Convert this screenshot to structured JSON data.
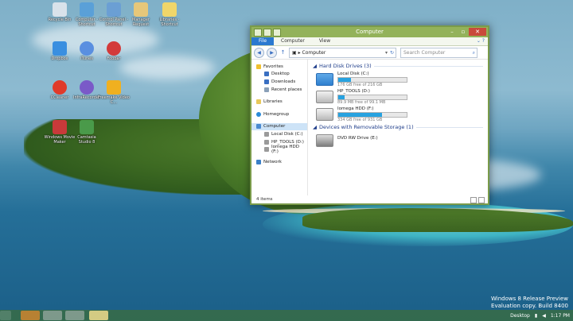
{
  "desktop": {
    "icons": [
      {
        "label": "Recycle Bin",
        "color": "#d9e2ea"
      },
      {
        "label": "Computer - Shortcut",
        "color": "#5aa0d8"
      },
      {
        "label": "Control Panel - Shortcut",
        "color": "#6b9fd4"
      },
      {
        "label": "Manager Request",
        "color": "#e6c77a"
      },
      {
        "label": "Libraries - Shortcut",
        "color": "#f0d66a"
      },
      {
        "label": "Dropbox",
        "color": "#3a8fe0"
      },
      {
        "label": "iTunes",
        "color": "#5a8fe0"
      },
      {
        "label": "Foobar",
        "color": "#d33a3a"
      },
      {
        "label": "CCleaner",
        "color": "#e03a2a"
      },
      {
        "label": "InfraRecorder",
        "color": "#7a5ac8"
      },
      {
        "label": "Freemake Video C...",
        "color": "#f0b020"
      },
      {
        "label": "Windows Movie Maker",
        "color": "#c83a3a"
      },
      {
        "label": "Camtasia Studio 8",
        "color": "#4a9a4a"
      }
    ],
    "watermark_line1": "Windows 8 Release Preview",
    "watermark_line2": "Evaluation copy. Build 8400"
  },
  "window": {
    "title": "Computer",
    "ribbon_tabs": [
      "File",
      "Computer",
      "View"
    ],
    "help_glyph": "⌄ ?",
    "address": "Computer",
    "search_placeholder": "Search Computer",
    "nav": {
      "favorites": "Favorites",
      "desktop": "Desktop",
      "downloads": "Downloads",
      "recent": "Recent places",
      "libraries": "Libraries",
      "homegroup": "Homegroup",
      "computer": "Computer",
      "local_disk": "Local Disk (C:)",
      "hp_tools": "HP_TOOLS (D:)",
      "iomega": "Iomega HDD (F:)",
      "network": "Network"
    },
    "groups": {
      "hard_disk": "Hard Disk Drives (3)",
      "removable": "Devices with Removable Storage (1)"
    },
    "drives": [
      {
        "name": "Local Disk (C:)",
        "free": "176 GB free of 216 GB",
        "used_fraction": 0.19
      },
      {
        "name": "HP_TOOLS (D:)",
        "free": "89.9 MB free of 99.1 MB",
        "used_fraction": 0.09
      },
      {
        "name": "Iomega HDD (F:)",
        "free": "334 GB free of 931 GB",
        "used_fraction": 0.64
      }
    ],
    "dvd": {
      "name": "DVD RW Drive (E:)"
    },
    "status": "4 items"
  },
  "taskbar": {
    "desktop_label": "Desktop",
    "time": "1:17 PM"
  }
}
